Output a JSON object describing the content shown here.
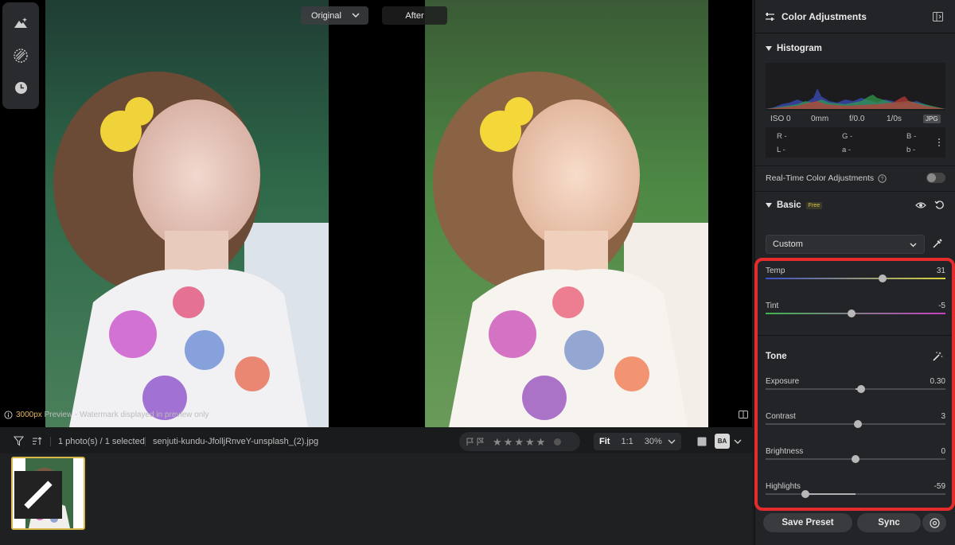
{
  "preview": {
    "compare_original_label": "Original",
    "compare_after_label": "After",
    "note_px": "3000px",
    "note_text": "Preview - Watermark displayed in preview only"
  },
  "bottombar": {
    "selection": "1 photo(s) / 1 selected",
    "filename": "senjuti-kundu-JfolljRnveY-unsplash_(2).jpg",
    "zoom_fit": "Fit",
    "zoom_1to1": "1:1",
    "zoom_percent": "30%",
    "ba_label": "BA",
    "stars": [
      "★",
      "★",
      "★",
      "★",
      "★"
    ]
  },
  "panel": {
    "title": "Color Adjustments",
    "histogram_title": "Histogram",
    "exif": {
      "iso": "ISO 0",
      "focal": "0mm",
      "aperture": "f/0.0",
      "shutter": "1/0s",
      "format": "JPG"
    },
    "rgb": {
      "r": "R -",
      "g": "G -",
      "b": "B -",
      "l": "L -",
      "a": "a -",
      "b2": "b -"
    },
    "realtime_label": "Real-Time Color Adjustments",
    "basic_title": "Basic",
    "free_badge": "Free",
    "preset_value": "Custom",
    "tone_title": "Tone",
    "sliders": [
      {
        "label": "Temp",
        "value": "31",
        "pos": 0.65
      },
      {
        "label": "Tint",
        "value": "-5",
        "pos": 0.48
      },
      {
        "label": "Exposure",
        "value": "0.30",
        "pos": 0.53
      },
      {
        "label": "Contrast",
        "value": "3",
        "pos": 0.515
      },
      {
        "label": "Brightness",
        "value": "0",
        "pos": 0.5
      },
      {
        "label": "Highlights",
        "value": "-59",
        "pos": 0.22
      }
    ],
    "save_preset": "Save Preset",
    "sync": "Sync"
  },
  "colors": {
    "accent_highlight": "#e52b2b",
    "thumb_border": "#d9b84b"
  }
}
